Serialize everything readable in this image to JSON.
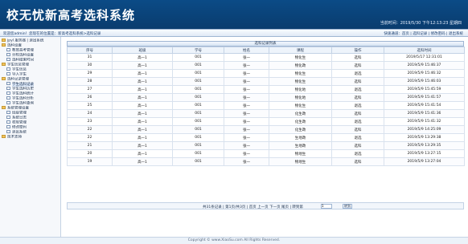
{
  "header": {
    "title": "校无忧新高考选科系统",
    "time_text": "当前时间：2019/5/30 下午12:13:23 星期四"
  },
  "topbar": {
    "welcome": "欢迎您admin！您现在的位置是：新高考选科系统>选科记录",
    "links": "快速通道：首页 | 选科记录 | 修改密码 | 退出系统"
  },
  "sidebar": {
    "items": [
      {
        "label": "jpyl 服务器 | 退出系统",
        "level": 0,
        "type": "folder"
      },
      {
        "label": "选科设置",
        "level": 0,
        "type": "folder"
      },
      {
        "label": "教育高考管理",
        "level": 1,
        "type": "page"
      },
      {
        "label": "分校选科设置",
        "level": 1,
        "type": "page"
      },
      {
        "label": "选科结束时间",
        "level": 1,
        "type": "page"
      },
      {
        "label": "学生信息管理",
        "level": 0,
        "type": "folder"
      },
      {
        "label": "学生信息",
        "level": 1,
        "type": "page"
      },
      {
        "label": "导入学生",
        "level": 1,
        "type": "page"
      },
      {
        "label": "选科记录管理",
        "level": 0,
        "type": "folder"
      },
      {
        "label": "学生选科记录",
        "level": 1,
        "type": "page",
        "selected": true
      },
      {
        "label": "学生选科历史",
        "level": 1,
        "type": "page"
      },
      {
        "label": "学生选科统计",
        "level": 1,
        "type": "page"
      },
      {
        "label": "学生选科分析",
        "level": 1,
        "type": "page"
      },
      {
        "label": "学生选科查询",
        "level": 1,
        "type": "page"
      },
      {
        "label": "系统管理设置",
        "level": 0,
        "type": "folder"
      },
      {
        "label": "班级管理",
        "level": 1,
        "type": "page"
      },
      {
        "label": "系统日志",
        "level": 1,
        "type": "page"
      },
      {
        "label": "权限管理",
        "level": 1,
        "type": "page"
      },
      {
        "label": "修改密码",
        "level": 1,
        "type": "page"
      },
      {
        "label": "退出系统",
        "level": 1,
        "type": "page"
      },
      {
        "label": "技术支持",
        "level": 0,
        "type": "folder"
      }
    ]
  },
  "main": {
    "table_title": "选科记录列表",
    "columns": [
      "序号",
      "班级",
      "学号",
      "姓名",
      "课程",
      "操作",
      "选科时间"
    ],
    "rows": [
      [
        "31",
        "高一1",
        "001",
        "张一",
        "物化生",
        "选科",
        "2019/5/17 12:31:01"
      ],
      [
        "30",
        "高一1",
        "001",
        "张一",
        "物化政",
        "选科",
        "2019/5/9 15:46:37"
      ],
      [
        "29",
        "高一1",
        "001",
        "张一",
        "物化生",
        "退选",
        "2019/5/9 15:46:32"
      ],
      [
        "28",
        "高一1",
        "001",
        "张一",
        "物化生",
        "选科",
        "2019/5/9 15:46:03"
      ],
      [
        "27",
        "高一1",
        "001",
        "张一",
        "物化地",
        "退选",
        "2019/5/9 15:45:59"
      ],
      [
        "26",
        "高一1",
        "001",
        "张一",
        "物化地",
        "选科",
        "2019/5/9 15:41:57"
      ],
      [
        "25",
        "高一1",
        "001",
        "张一",
        "物化生",
        "退选",
        "2019/5/9 15:41:54"
      ],
      [
        "24",
        "高一1",
        "001",
        "张一",
        "化生政",
        "选科",
        "2019/5/9 15:41:36"
      ],
      [
        "23",
        "高一1",
        "001",
        "张一",
        "化生政",
        "退选",
        "2019/5/9 15:41:32"
      ],
      [
        "22",
        "高一1",
        "001",
        "张一",
        "化生政",
        "选科",
        "2019/5/9 14:25:09"
      ],
      [
        "22",
        "高一1",
        "001",
        "张一",
        "生地政",
        "退选",
        "2019/5/9 13:29:38"
      ],
      [
        "21",
        "高一1",
        "001",
        "张一",
        "生地政",
        "选科",
        "2019/5/9 13:29:35"
      ],
      [
        "20",
        "高一1",
        "001",
        "张一",
        "物地生",
        "退选",
        "2019/5/9 13:27:15"
      ],
      [
        "19",
        "高一1",
        "001",
        "张一",
        "物地生",
        "选科",
        "2019/5/9 13:27:04"
      ]
    ],
    "pager_text": "共31条记录 | 第1页/共3页 | 首页 上一页 下一页 尾页 | 转到第",
    "pager_input_value": "1",
    "pager_button": "转到"
  },
  "footer": {
    "text": "Copyright © www.XiaoSu.com All Rights Reserved."
  },
  "colors": {
    "header_bg": "#0b4b86",
    "withdraw": "#d40000"
  }
}
